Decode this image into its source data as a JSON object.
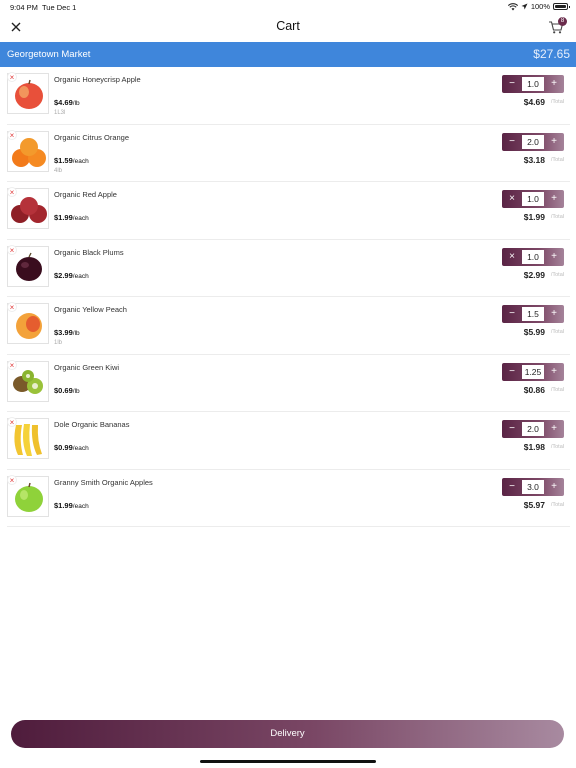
{
  "status_bar": {
    "time": "9:04 PM",
    "date": "Tue Dec 1",
    "battery": "100%"
  },
  "nav": {
    "title": "Cart",
    "cart_count": "8",
    "close_icon": "close-icon",
    "cart_icon": "shopping-cart-icon"
  },
  "store": {
    "name": "Georgetown Market",
    "total": "$27.65",
    "color": "#3f86db"
  },
  "items": [
    {
      "name": "Organic Honeycrisp Apple",
      "price": "$4.69",
      "unit": "/lb",
      "note": "1L3l",
      "qty": "1.0",
      "left_btn": "−",
      "total": "$4.69",
      "total_suffix": "/Total"
    },
    {
      "name": "Organic Citrus Orange",
      "price": "$1.59",
      "unit": "/each",
      "note": "4lb",
      "qty": "2.0",
      "left_btn": "−",
      "total": "$3.18",
      "total_suffix": "/Total"
    },
    {
      "name": "Organic Red Apple",
      "price": "$1.99",
      "unit": "/each",
      "note": "",
      "qty": "1.0",
      "left_btn": "×",
      "total": "$1.99",
      "total_suffix": "/Total"
    },
    {
      "name": "Organic Black Plums",
      "price": "$2.99",
      "unit": "/each",
      "note": "",
      "qty": "1.0",
      "left_btn": "×",
      "total": "$2.99",
      "total_suffix": "/Total"
    },
    {
      "name": "Organic Yellow Peach",
      "price": "$3.99",
      "unit": "/lb",
      "note": "1lb",
      "qty": "1.5",
      "left_btn": "−",
      "total": "$5.99",
      "total_suffix": "/Total"
    },
    {
      "name": "Organic Green Kiwi",
      "price": "$0.69",
      "unit": "/lb",
      "note": "",
      "qty": "1.25",
      "left_btn": "−",
      "total": "$0.86",
      "total_suffix": "/Total"
    },
    {
      "name": "Dole Organic Bananas",
      "price": "$0.99",
      "unit": "/each",
      "note": "",
      "qty": "2.0",
      "left_btn": "−",
      "total": "$1.98",
      "total_suffix": "/Total"
    },
    {
      "name": "Granny Smith Organic Apples",
      "price": "$1.99",
      "unit": "/each",
      "note": "",
      "qty": "3.0",
      "left_btn": "−",
      "total": "$5.97",
      "total_suffix": "/Total"
    }
  ],
  "remove_label": "×",
  "plus_label": "+",
  "delivery": {
    "label": "Delivery"
  },
  "colors": {
    "accent": "#5a2445",
    "remove": "#e03a3a"
  }
}
